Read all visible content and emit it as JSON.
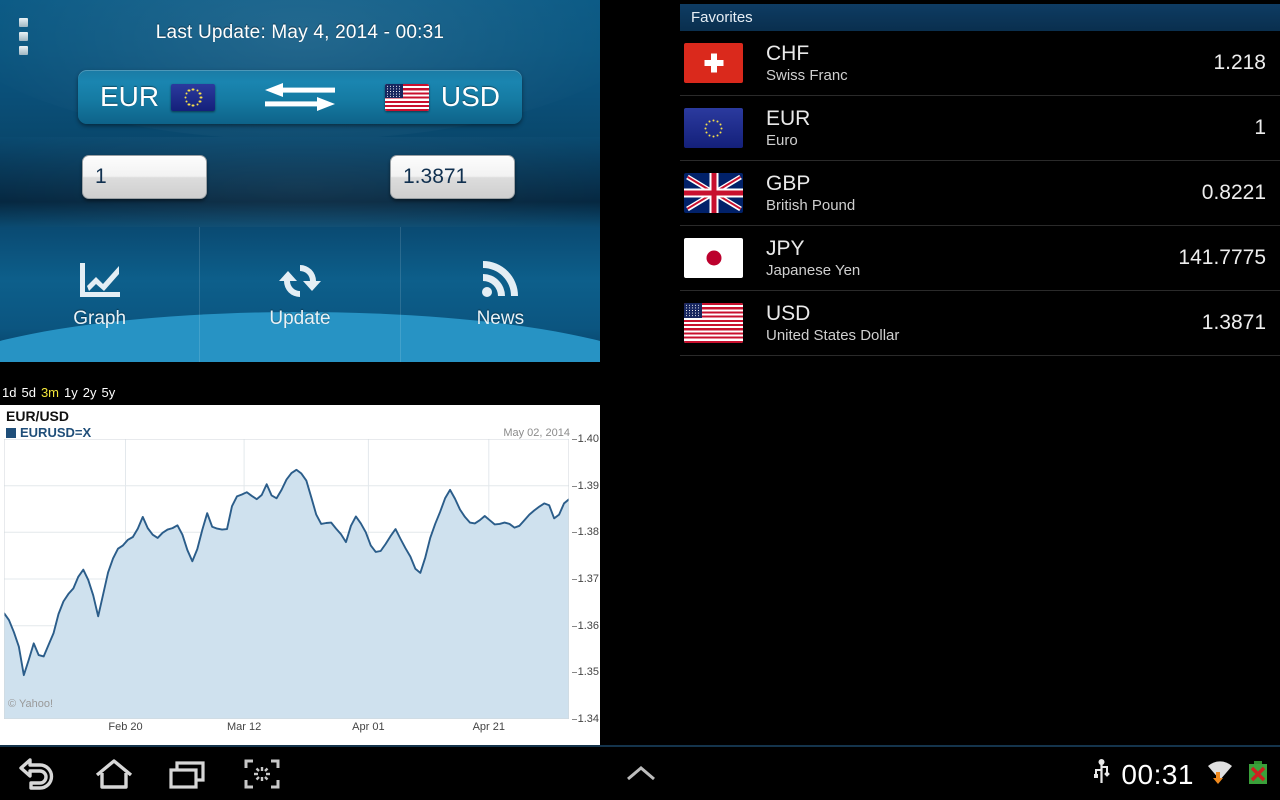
{
  "converter": {
    "last_update": "Last Update: May 4, 2014 - 00:31",
    "menu_icon": "overflow-menu-icon",
    "from_code": "EUR",
    "from_flag": "eu",
    "to_code": "USD",
    "to_flag": "us",
    "swap_icon": "swap-arrows-icon",
    "amount_from": "1",
    "amount_to": "1.3871",
    "clear_icon": "clear-x-icon",
    "actions": [
      {
        "label": "Graph",
        "icon": "graph-icon"
      },
      {
        "label": "Update",
        "icon": "refresh-icon"
      },
      {
        "label": "News",
        "icon": "rss-icon"
      }
    ]
  },
  "ranges": {
    "options": [
      "1d",
      "5d",
      "3m",
      "1y",
      "2y",
      "5y"
    ],
    "selected": "3m"
  },
  "chart_data": {
    "type": "line",
    "title": "EUR/USD",
    "legend": [
      "EURUSD=X"
    ],
    "legend_position": "top-left",
    "annotation": "May 02, 2014",
    "watermark": "© Yahoo!",
    "xlabel": "",
    "ylabel": "",
    "ylim": [
      1.34,
      1.4
    ],
    "yticks": [
      "1.40",
      "1.39",
      "1.38",
      "1.37",
      "1.36",
      "1.35",
      "1.34"
    ],
    "xticks": [
      "Feb 20",
      "Mar 12",
      "Apr 01",
      "Apr 21"
    ],
    "xtick_positions": [
      0.215,
      0.425,
      0.645,
      0.858
    ],
    "grid": true,
    "line_color": "#2b5d8a",
    "fill_color": "#cfe1ee",
    "series": [
      {
        "name": "EURUSD=X",
        "values": [
          1.3627,
          1.3612,
          1.3586,
          1.3555,
          1.3494,
          1.3527,
          1.3562,
          1.3537,
          1.3534,
          1.3559,
          1.3584,
          1.3625,
          1.3652,
          1.3668,
          1.368,
          1.3705,
          1.372,
          1.3698,
          1.3665,
          1.362,
          1.3667,
          1.3714,
          1.3744,
          1.3765,
          1.3772,
          1.3784,
          1.379,
          1.3808,
          1.3833,
          1.3809,
          1.3795,
          1.3788,
          1.3799,
          1.3806,
          1.3809,
          1.3815,
          1.3795,
          1.3762,
          1.3738,
          1.3764,
          1.3805,
          1.3841,
          1.3812,
          1.3808,
          1.3806,
          1.3807,
          1.3856,
          1.3877,
          1.3881,
          1.3886,
          1.3878,
          1.3871,
          1.388,
          1.3903,
          1.3879,
          1.3873,
          1.3891,
          1.3913,
          1.3927,
          1.3934,
          1.3926,
          1.3911,
          1.3875,
          1.3838,
          1.3818,
          1.382,
          1.3821,
          1.3808,
          1.3796,
          1.3779,
          1.3814,
          1.3834,
          1.3819,
          1.38,
          1.3772,
          1.3758,
          1.376,
          1.3775,
          1.3792,
          1.3807,
          1.3786,
          1.3766,
          1.3748,
          1.3722,
          1.3713,
          1.3746,
          1.3788,
          1.3818,
          1.3844,
          1.3873,
          1.3891,
          1.3872,
          1.3849,
          1.3833,
          1.3821,
          1.3819,
          1.3826,
          1.3835,
          1.3826,
          1.3817,
          1.3818,
          1.3821,
          1.3818,
          1.381,
          1.3814,
          1.3826,
          1.3838,
          1.3847,
          1.3855,
          1.3862,
          1.3858,
          1.383,
          1.3838,
          1.3862,
          1.3871
        ]
      }
    ]
  },
  "favorites": {
    "header": "Favorites",
    "rows": [
      {
        "code": "CHF",
        "name": "Swiss Franc",
        "value": "1.218",
        "flag": "ch"
      },
      {
        "code": "EUR",
        "name": "Euro",
        "value": "1",
        "flag": "eu"
      },
      {
        "code": "GBP",
        "name": "British Pound",
        "value": "0.8221",
        "flag": "gb"
      },
      {
        "code": "JPY",
        "name": "Japanese Yen",
        "value": "141.7775",
        "flag": "jp"
      },
      {
        "code": "USD",
        "name": "United States Dollar",
        "value": "1.3871",
        "flag": "us"
      }
    ]
  },
  "system_bar": {
    "back_icon": "back-icon",
    "home_icon": "home-icon",
    "recents_icon": "recent-apps-icon",
    "screenshot_icon": "screenshot-icon",
    "expand_icon": "chevron-up-icon",
    "usb_icon": "usb-icon",
    "clock": "00:31",
    "wifi_icon": "wifi-icon",
    "battery_icon": "battery-error-icon"
  }
}
